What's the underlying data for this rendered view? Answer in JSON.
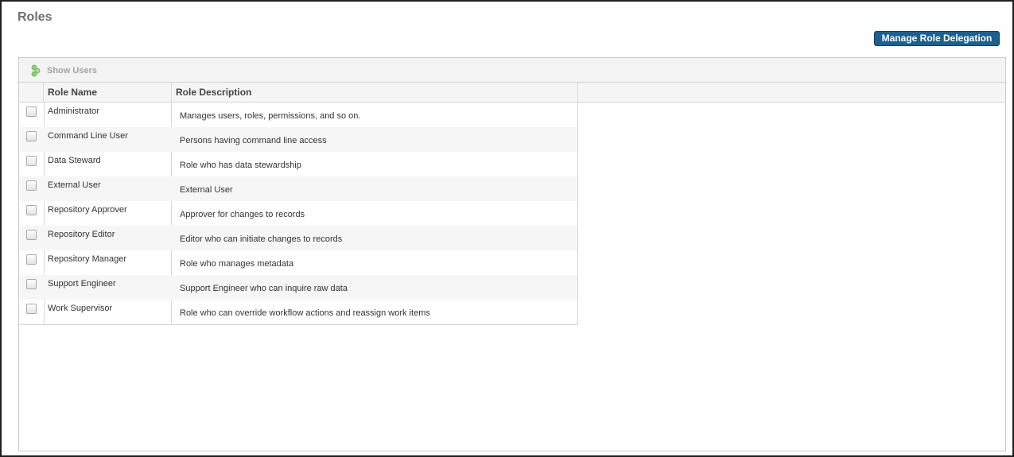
{
  "page": {
    "title": "Roles"
  },
  "actions": {
    "manage_role_delegation": "Manage Role Delegation"
  },
  "toolbar": {
    "show_users_label": "Show Users",
    "show_users_icon": "users-icon"
  },
  "table": {
    "columns": [
      "Role Name",
      "Role Description"
    ],
    "rows": [
      {
        "name": "Administrator",
        "description": "Manages users, roles, permissions, and so on.",
        "checked": false
      },
      {
        "name": "Command Line User",
        "description": "Persons having command line access",
        "checked": false
      },
      {
        "name": "Data Steward",
        "description": "Role who has data stewardship",
        "checked": false
      },
      {
        "name": "External User",
        "description": "External User",
        "checked": false
      },
      {
        "name": "Repository Approver",
        "description": "Approver for changes to records",
        "checked": false
      },
      {
        "name": "Repository Editor",
        "description": "Editor who can initiate changes to records",
        "checked": false
      },
      {
        "name": "Repository Manager",
        "description": "Role who manages metadata",
        "checked": false
      },
      {
        "name": "Support Engineer",
        "description": "Support Engineer who can inquire raw data",
        "checked": false
      },
      {
        "name": "Work Supervisor",
        "description": "Role who can override workflow actions and reassign work items",
        "checked": false
      }
    ]
  },
  "colors": {
    "accent": "#1d5f8f",
    "title_text": "#6f6f6f",
    "icon_green": "#8ccf7a"
  }
}
